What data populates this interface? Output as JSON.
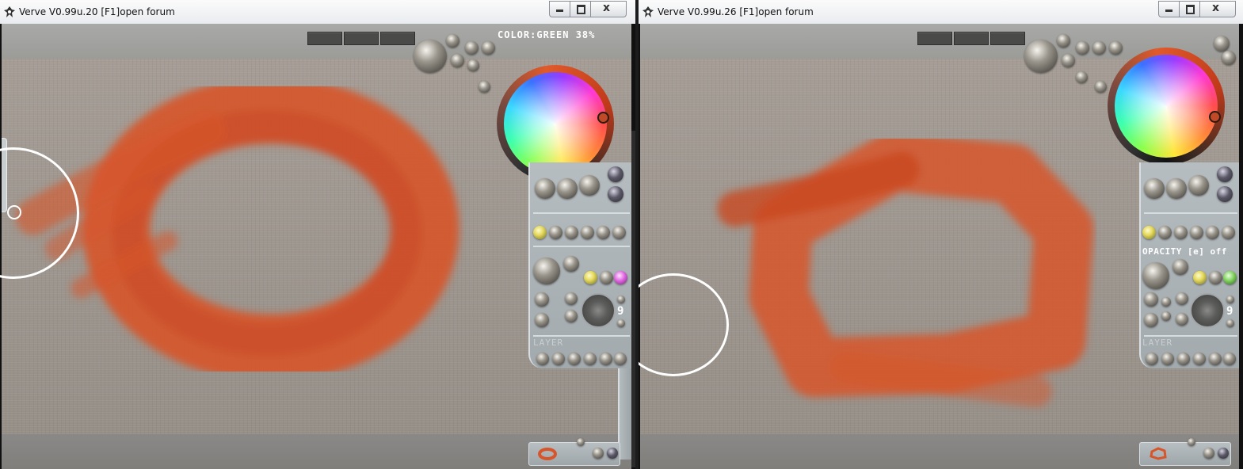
{
  "windows": [
    {
      "title": "Verve V0.99u.20 [F1]open forum",
      "panel_label": "COLOR:GREEN 38%",
      "layer_label": "LAYER",
      "brush_size": "9"
    },
    {
      "title": "Verve V0.99u.26 [F1]open forum",
      "panel_label": "OPACITY [e] off",
      "layer_label": "LAYER",
      "brush_size": "9"
    }
  ],
  "colors": {
    "paint": "#d7552a",
    "canvas": "#a19a93",
    "panel": "#aab1b5"
  },
  "icons": {
    "app": "verve-icon",
    "minimize": "minimize-icon",
    "maximize": "maximize-icon",
    "close": "close-icon"
  }
}
